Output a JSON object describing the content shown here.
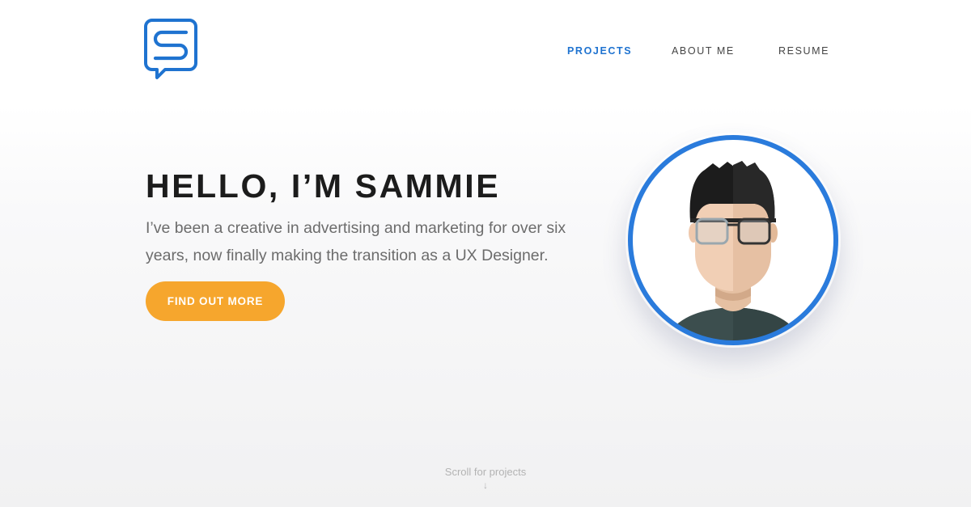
{
  "brand": {
    "logo_icon": "speech-bubble-s-logo",
    "color": "#1f73d0"
  },
  "nav": {
    "items": [
      {
        "label": "PROJECTS",
        "active": true
      },
      {
        "label": "ABOUT ME",
        "active": false
      },
      {
        "label": "RESUME",
        "active": false
      }
    ]
  },
  "hero": {
    "title": "HELLO, I’M SAMMIE",
    "intro": "I’ve been a creative in advertising and marketing for over six years, now finally making the transition as a UX Designer.",
    "cta_label": "FIND OUT MORE",
    "cta_color": "#f6a62d",
    "avatar_icon": "avatar-illustration",
    "avatar_ring_color": "#2a7bdc"
  },
  "scroll_hint": {
    "label": "Scroll for projects",
    "arrow": "↓"
  }
}
